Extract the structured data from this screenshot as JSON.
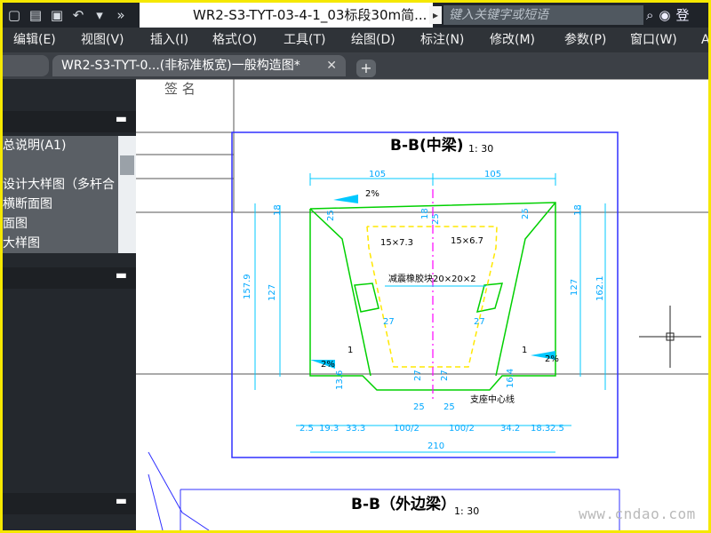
{
  "window": {
    "title": "WR2-S3-TYT-03-4-1_03标段30m简...",
    "search_placeholder": "键入关键字或短语",
    "user_label": "登"
  },
  "menu": [
    "编辑(E)",
    "视图(V)",
    "插入(I)",
    "格式(O)",
    "工具(T)",
    "绘图(D)",
    "标注(N)",
    "修改(M)",
    "参数(P)",
    "窗口(W)",
    "A"
  ],
  "tab": {
    "active_label": "WR2-S3-TYT-0...(非标准板宽)一般构造图*",
    "close_icon": "✕",
    "add_label": "+"
  },
  "sidebar": {
    "items": [
      "总说明(A1)",
      "",
      "设计大样图（多杆合",
      "横断面图",
      "面图",
      "大样图"
    ]
  },
  "drawing": {
    "header_label": "签    名",
    "section1": {
      "title": "B-B(中梁)",
      "scale": "1: 30",
      "top_left_dim": "105",
      "top_right_dim": "105",
      "slope_left": "2%",
      "slope_right": "2%",
      "strand_left": "15×7.3",
      "strand_right": "15×6.7",
      "bearing_text": "减震橡胶块20×20×2",
      "support_text": "支座中心线",
      "left_height": "157.9",
      "left_height_inner": "127",
      "right_height": "162.1",
      "right_height_inner": "127",
      "left_top": "18",
      "right_top": "18",
      "left_web": "25",
      "right_web": "25",
      "mid_top": "18",
      "mid_slope": "25",
      "inner_27_left": "27",
      "inner_27_right": "27",
      "inner_1_left": "1",
      "inner_1_right": "1",
      "bottom_13": "13.6",
      "bottom_right": "16.4",
      "bottom_27_left": "27",
      "bottom_27_right": "27",
      "bottom_dims": [
        "2.5",
        "19.3",
        "33.3",
        "100/2",
        "100/2",
        "34.2",
        "18.3",
        "2.5"
      ],
      "bottom_25_left": "25",
      "bottom_25_right": "25",
      "total_width": "210"
    },
    "section2": {
      "title": "B-B（外边梁）",
      "scale": "1: 30"
    }
  },
  "watermark": "www.cndao.com",
  "colors": {
    "titlebar": "#1f2329",
    "menubar": "#2f3338",
    "frame": "#f5e800",
    "dimension": "#00c8ff",
    "outline": "#00d000",
    "dashed": "#ffe800",
    "axis": "#ff00ff",
    "text": "#0000ff"
  }
}
